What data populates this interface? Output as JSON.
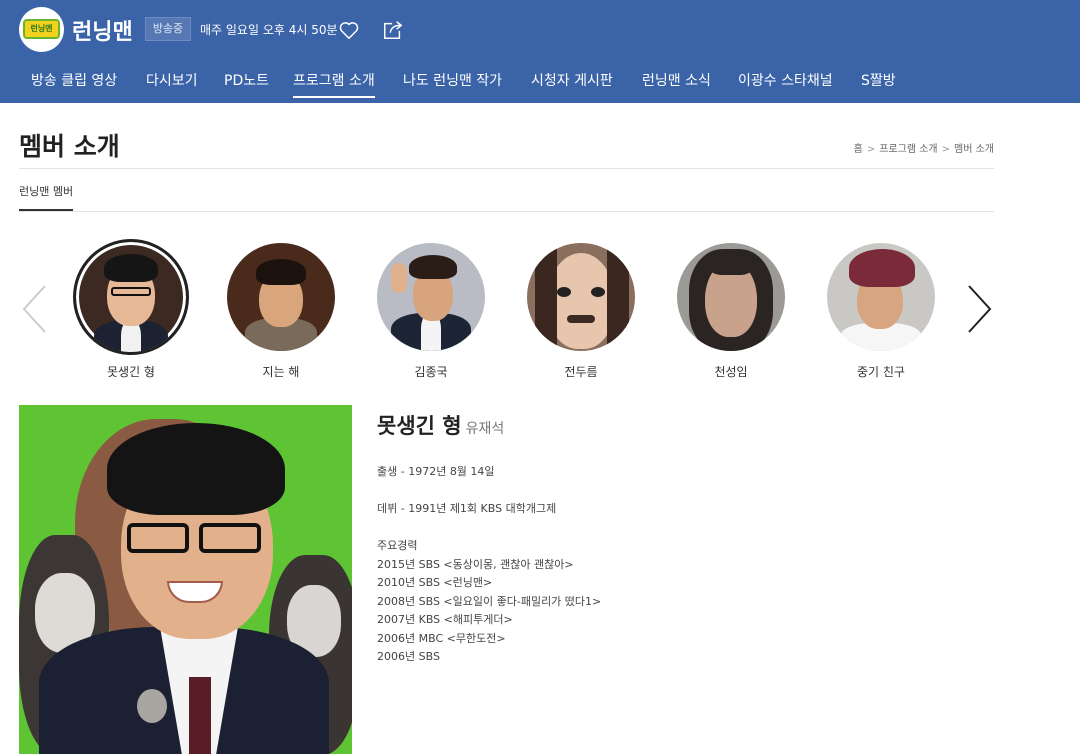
{
  "header": {
    "logo_text": "런닝맨",
    "title": "런닝맨",
    "onair_badge": "방송중",
    "schedule": "매주 일요일 오후 4시 50분"
  },
  "nav": {
    "items": [
      {
        "label": "방송 클립 영상"
      },
      {
        "label": "다시보기"
      },
      {
        "label": "PD노트"
      },
      {
        "label": "프로그램 소개",
        "active": true
      },
      {
        "label": "나도 런닝맨 작가"
      },
      {
        "label": "시청자 게시판"
      },
      {
        "label": "런닝맨 소식"
      },
      {
        "label": "이광수 스타채널"
      },
      {
        "label": "S짤방"
      }
    ]
  },
  "page": {
    "title": "멤버 소개",
    "breadcrumb": [
      "홈",
      "프로그램 소개",
      "멤버 소개"
    ],
    "subtab": "런닝맨 멤버"
  },
  "members": [
    {
      "nickname": "못생긴 형",
      "selected": true
    },
    {
      "nickname": "지는 해"
    },
    {
      "nickname": "김종국"
    },
    {
      "nickname": "전두름"
    },
    {
      "nickname": "천성임"
    },
    {
      "nickname": "중기 친구"
    }
  ],
  "detail": {
    "nickname": "못생긴 형",
    "real_name": "유재석",
    "birth": "출생 - 1972년 8월 14일",
    "debut": "데뷔 - 1991년 제1회 KBS 대학개그제",
    "career_heading": "주요경력",
    "career": [
      "2015년 SBS <동상이몽, 괜찮아 괜찮아>",
      "2010년 SBS <런닝맨>",
      "2008년 SBS <일요일이 좋다-패밀리가 떴다1>",
      "2007년 KBS <해피투게더>",
      "2006년 MBC <무한도전>",
      "2006년 SBS"
    ]
  },
  "colors": {
    "header_bg": "#3a63a8",
    "photo_bg": "#5ec433"
  }
}
